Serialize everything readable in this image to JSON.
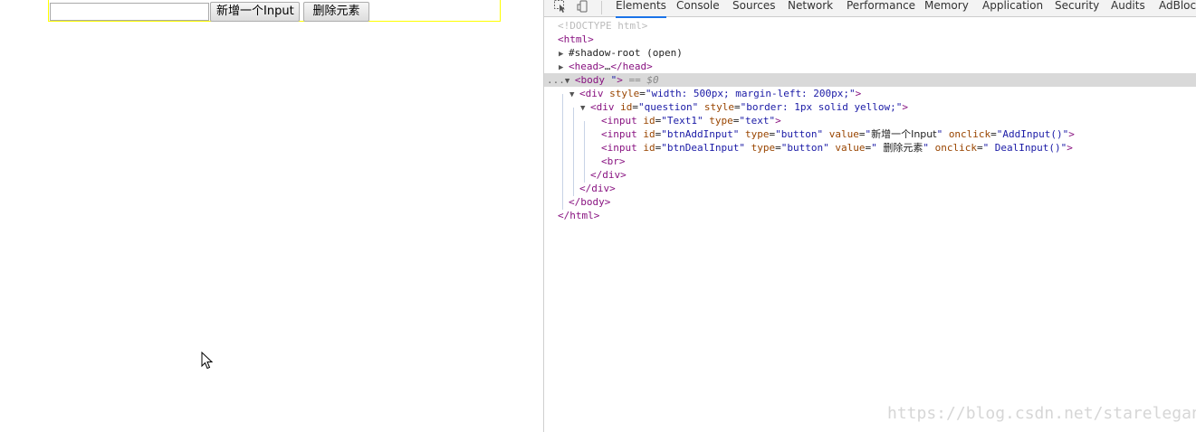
{
  "page": {
    "text_input_value": "",
    "add_button_label": "新增一个Input",
    "delete_button_label": "删除元素"
  },
  "devtools": {
    "tabs": [
      "Elements",
      "Console",
      "Sources",
      "Network",
      "Performance",
      "Memory",
      "Application",
      "Security",
      "Audits",
      "AdBlock"
    ],
    "active_tab": "Elements",
    "dom": {
      "doctype": "<!DOCTYPE html>",
      "html_open": "<html>",
      "shadow_root": "#shadow-root (open)",
      "head_open": "<head>",
      "head_ellipsis": "…",
      "head_close": "</head>",
      "selection_dots": "...",
      "body_open": "<body ",
      "body_quote": "\"",
      "body_gt": ">",
      "eq_dollar": " == $0",
      "div_outer_tag": "<div",
      "div_outer_style_name": "style",
      "div_outer_style_val": "\"width: 500px; margin-left: 200px;\"",
      "div_q_tag": "<div",
      "div_q_id_name": "id",
      "div_q_id_val": "\"question\"",
      "div_q_style_name": "style",
      "div_q_style_val": "\"border: 1px solid yellow;\"",
      "input1_tag": "<input",
      "input1_id_name": "id",
      "input1_id_val": "\"Text1\"",
      "input1_type_name": "type",
      "input1_type_val": "\"text\"",
      "input2_tag": "<input",
      "input2_id_name": "id",
      "input2_id_val": "\"btnAddInput\"",
      "input2_type_name": "type",
      "input2_type_val": "\"button\"",
      "input2_value_name": "value",
      "input2_value_q1": "\"",
      "input2_value_text": "新增一个Input",
      "input2_value_q2": "\"",
      "input2_onclick_name": "onclick",
      "input2_onclick_val": "\"AddInput()\"",
      "input3_tag": "<input",
      "input3_id_name": "id",
      "input3_id_val": "\"btnDealInput\"",
      "input3_type_name": "type",
      "input3_type_val": "\"button\"",
      "input3_value_name": "value",
      "input3_value_q1": "\" ",
      "input3_value_text": "删除元素",
      "input3_value_q2": "\"",
      "input3_onclick_name": "onclick",
      "input3_onclick_val": "\" DealInput()\"",
      "br_tag": "<br>",
      "div_close_1": "</div>",
      "div_close_2": "</div>",
      "body_close": "</body>",
      "html_close": "</html>",
      "gt": ">",
      "eq": "="
    }
  },
  "watermark": "https://blog.csdn.net/starelegant",
  "colors": {
    "question_border": "#ffff00",
    "tag": "#881280",
    "attr_name": "#994500",
    "attr_value": "#1a1aa6",
    "selected_row": "#d9d9d9",
    "active_tab_underline": "#1a73e8"
  },
  "icons": [
    "mouse-cursor-icon",
    "inspect-element-icon",
    "device-toolbar-icon",
    "expand-triangle-icon",
    "collapse-triangle-icon"
  ]
}
